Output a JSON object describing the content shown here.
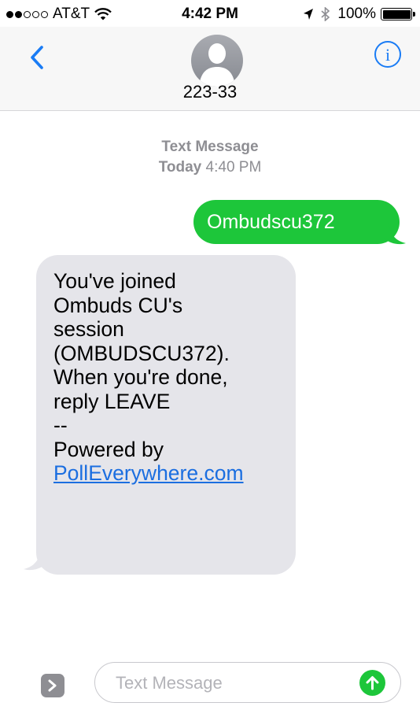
{
  "status_bar": {
    "carrier": "AT&T",
    "time": "4:42 PM",
    "battery": "100%",
    "signal_bars_filled": 2,
    "signal_bars_total": 5
  },
  "header": {
    "contact_name": "223-33"
  },
  "thread": {
    "timestamp_label": "Text Message",
    "timestamp_day": "Today",
    "timestamp_time": "4:40 PM",
    "messages": [
      {
        "direction": "outgoing",
        "text": "Ombudscu372"
      },
      {
        "direction": "incoming",
        "lines": [
          "You've joined",
          "Ombuds CU's",
          "session",
          "(OMBUDSCU372).",
          "When you're done,",
          "reply LEAVE",
          "--",
          "Powered by"
        ],
        "link": "PollEverywhere.com"
      }
    ]
  },
  "composer": {
    "placeholder": "Text Message"
  },
  "colors": {
    "accent": "#1a7cf5",
    "outgoing_bubble": "#1dc63a",
    "incoming_bubble": "#e5e5ea",
    "timestamp": "#8e8e93"
  },
  "icons": [
    "wifi-icon",
    "location-arrow-icon",
    "bluetooth-icon",
    "battery-icon",
    "back-chevron-icon",
    "contact-avatar-icon",
    "info-icon",
    "apps-chevron-icon",
    "send-arrow-icon"
  ]
}
